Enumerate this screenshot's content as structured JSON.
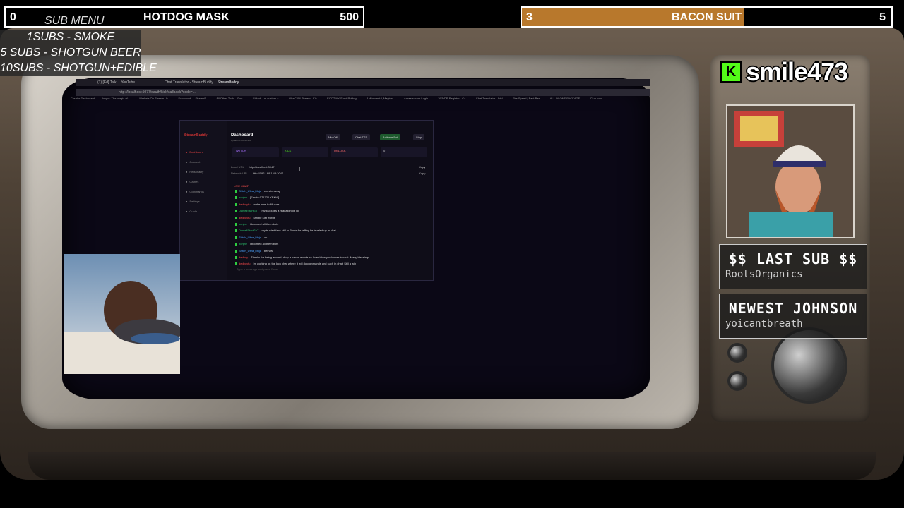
{
  "goals": {
    "left": {
      "count": "0",
      "subtitle": "SUB MENU",
      "title": "HOTDOG MASK",
      "target": "500"
    },
    "right": {
      "count": "3",
      "title": "BACON SUIT",
      "target": "5",
      "progress_fraction": 0.6,
      "fill_color": "#b8782c"
    }
  },
  "submenu": [
    "1SUBS   - SMOKE",
    "5 SUBS  - SHOTGUN BEER",
    "10SUBS - SHOTGUN+EDIBLE"
  ],
  "streamer": {
    "platform_icon": "kick-logo",
    "platform_letter": "K",
    "channel": "smile473"
  },
  "alerts": {
    "last_sub_head": "$$ LAST SUB $$",
    "last_sub_value": "RootsOrganics",
    "newest_head": "NEWEST JOHNSON",
    "newest_value": "yoicantbreath"
  },
  "browser": {
    "tabs": [
      "(1) [Ed] Talk ... YouTube",
      "Chat Translator - StreamBuddy",
      "StreamBuddy"
    ],
    "url": "http://localhost:5077/oauth/kick/callback?code=...",
    "bookmarks": [
      "Creator Dashboard",
      "Imgur: The magic of t...",
      "Markets On Stream Us...",
      "Download — StreamB...",
      "All Other Tools - Gou...",
      "GitHub - ai-custom-s...",
      "AlbaCYM Stream - Kic...",
      "ECOTINY Sand Rolling...",
      "A Wonderful, Magical ...",
      "Amazon.com Login...",
      "VENDR Register - Ca...",
      "Chat Translator - Add...",
      "FirstSpeed | Fast Bas...",
      "ALL-IN-ONE PACKAGE...",
      "Club.com"
    ]
  },
  "app": {
    "brand": "StreamBuddy",
    "title": "Dashboard",
    "subtitle": "1 platform connected",
    "nav": [
      "Dashboard",
      "Connect",
      "Personality",
      "Games",
      "Commands",
      "Settings",
      "Guide"
    ],
    "buttons": [
      "Mic Off",
      "Chat TTS",
      "Activate Bot",
      "Stop"
    ],
    "stats": [
      "TWITCH",
      "KICK",
      "UNLOCK",
      "0"
    ],
    "urls": [
      {
        "label": "Local URL",
        "value": "http://localhost:3047",
        "copy": "Copy"
      },
      {
        "label": "Network URL",
        "value": "http://192.168.1.43:3047",
        "copy": "Copy"
      }
    ],
    "chat_label": "LIVE CHAT",
    "chat": [
      {
        "user": "Shtuh_Ultra_Muja",
        "msg": "chewie away",
        "color": "#4aa3ff"
      },
      {
        "user": "bonjne",
        "msg": "[Emote:171720 KEKW]",
        "color": "#2ecc71"
      },
      {
        "user": "dedboyfu",
        "msg": "make sure to fill cure",
        "color": "#ff4d4d"
      },
      {
        "user": "DaniellStartGoT",
        "msg": "my k1d4obs a real asshole lol",
        "color": "#2ecc71"
      },
      {
        "user": "dedboyfu",
        "msg": "can be just words",
        "color": "#ff4d4d"
      },
      {
        "user": "bonjne",
        "msg": "i boomed all them bots",
        "color": "#2ecc71"
      },
      {
        "user": "DaniellStartGoT",
        "msg": "my trusted fans still to Bonts for telling he leveled up in chat",
        "color": "#2ecc71"
      },
      {
        "user": "Shtuh_Ultra_Muja",
        "msg": "ok",
        "color": "#4aa3ff"
      },
      {
        "user": "bonjne",
        "msg": "i boomed all them bots",
        "color": "#2ecc71"
      },
      {
        "user": "Shtuh_Ultra_Muja",
        "msg": "bel war",
        "color": "#4aa3ff"
      },
      {
        "user": "dedboy",
        "msg": "Thanks for being around, drop a bacon emote so I can blow you kisses in chat. Many blessings",
        "color": "#ff4d4d"
      },
      {
        "user": "dedboyfu",
        "msg": "Im working on the kick chat where it will do commands and such in chat. Still a wip",
        "color": "#ff4d4d"
      }
    ],
    "chat_placeholder": "Type a message and press Enter"
  }
}
